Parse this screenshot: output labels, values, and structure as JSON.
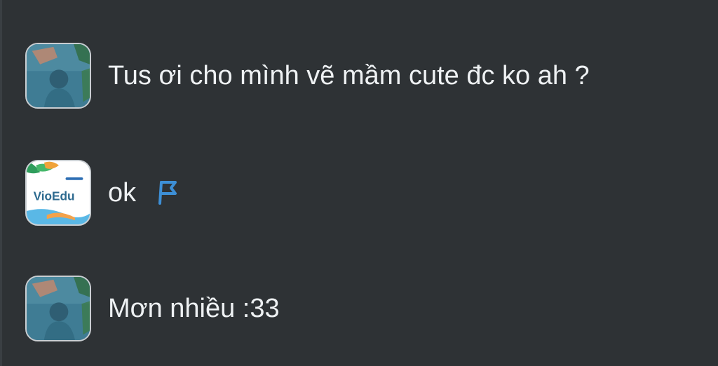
{
  "comments": [
    {
      "avatar_icon": "user-photo-icon",
      "text": "Tus ơi cho mình vẽ mầm cute đc ko ah ?"
    },
    {
      "avatar_icon": "vioedu-logo-icon",
      "avatar_logo_text": "VioEdu",
      "text": "ok",
      "flag_icon": "flag-icon",
      "flag_color": "#3d8fd6"
    },
    {
      "avatar_icon": "user-photo-icon",
      "text": "Mơn nhiều :33"
    }
  ],
  "colors": {
    "background": "#2e3235",
    "text": "#eef1f3",
    "avatar_border": "#c9ced2"
  }
}
